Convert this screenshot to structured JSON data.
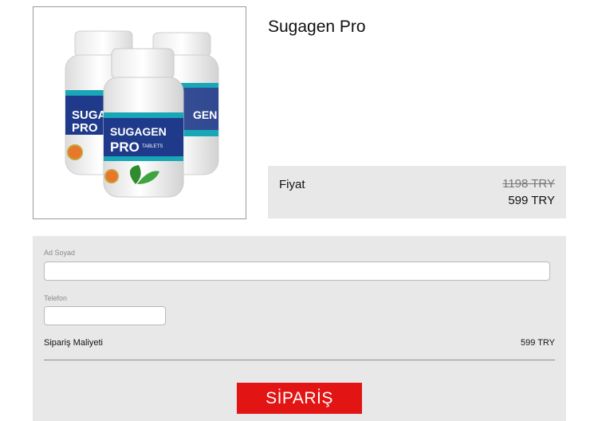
{
  "product": {
    "title": "Sugagen Pro",
    "image_alt": "Sugagen Pro product bottles",
    "bottle_brand_line1": "SUGAGEN",
    "bottle_brand_line2": "PRO",
    "bottle_tag": "TABLETS"
  },
  "price": {
    "label": "Fiyat",
    "old": "1198 TRY",
    "current": "599 TRY"
  },
  "form": {
    "name_label": "Ad Soyad",
    "name_value": "",
    "phone_label": "Telefon",
    "phone_value": "",
    "cost_label": "Sipariş Maliyeti",
    "cost_value": "599 TRY",
    "submit_label": "SİPARİŞ"
  },
  "colors": {
    "button": "#e31414",
    "panel": "#e8e8e8",
    "bottle_label": "#1f3a8a",
    "bottle_accent": "#19a7b7",
    "leaf": "#2e8b2e"
  }
}
